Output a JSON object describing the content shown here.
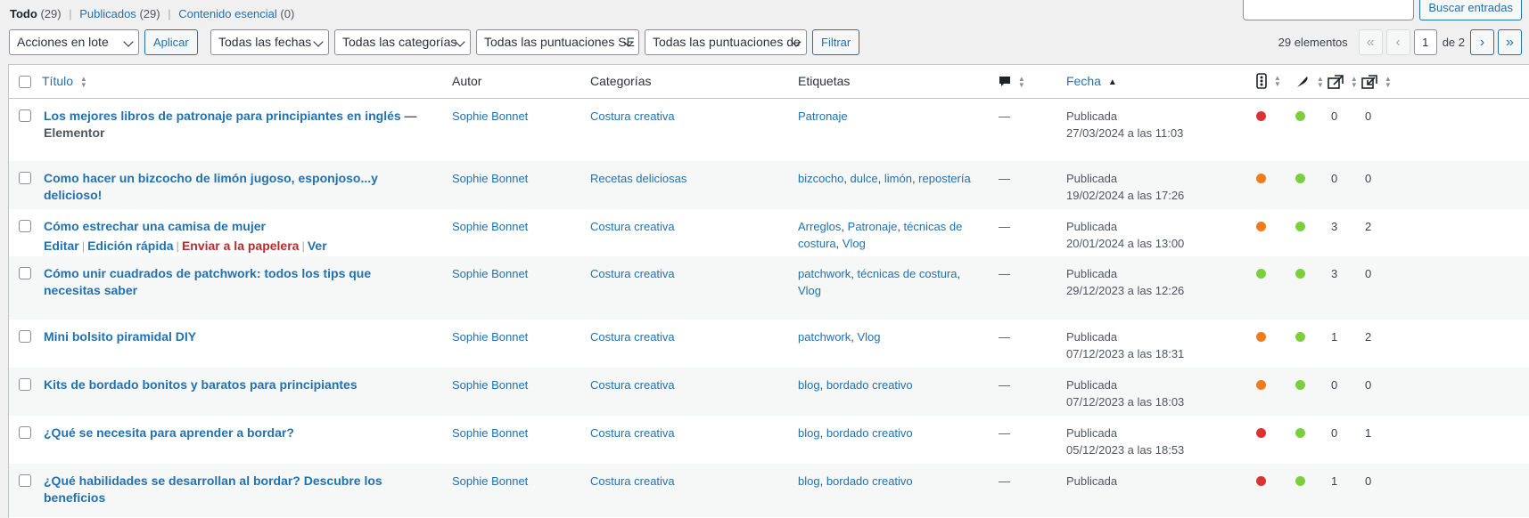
{
  "filters_nav": {
    "all_label": "Todo",
    "all_count": "(29)",
    "published_label": "Publicados",
    "published_count": "(29)",
    "essential_label": "Contenido esencial",
    "essential_count": "(0)"
  },
  "search": {
    "placeholder": "",
    "button_label": "Buscar entradas"
  },
  "toolbar": {
    "bulk_actions": "Acciones en lote",
    "apply_label": "Aplicar",
    "dates_filter": "Todas las fechas",
    "categories_filter": "Todas las categorías",
    "seo_scores_filter": "Todas las puntuaciones SE",
    "readability_filter": "Todas las puntuaciones de",
    "filter_label": "Filtrar"
  },
  "pagination": {
    "items_count": "29 elementos",
    "first": "«",
    "prev": "‹",
    "current_page": "1",
    "of_label": "de 2",
    "next": "›",
    "last": "»"
  },
  "columns": {
    "title": "Título",
    "author": "Autor",
    "categories": "Categorías",
    "tags": "Etiquetas",
    "date": "Fecha"
  },
  "status_colors": {
    "red": "#dc3232",
    "orange": "#ee7c1b",
    "green": "#7ad03a"
  },
  "posts": [
    {
      "title": "Los mejores libros de patronaje para principiantes en inglés",
      "title_suffix": " — Elementor",
      "author": "Sophie Bonnet",
      "category": "Costura creativa",
      "tags": [
        "Patronaje"
      ],
      "comments": "—",
      "status": "Publicada",
      "date": "27/03/2024 a las 11:03",
      "seo": "red",
      "readability": "green",
      "links_in": "0",
      "links_out": "0"
    },
    {
      "title": "Como hacer un bizcocho de limón jugoso, esponjoso...y delicioso!",
      "title_suffix": "",
      "author": "Sophie Bonnet",
      "category": "Recetas deliciosas",
      "tags": [
        "bizcocho",
        "dulce",
        "limón",
        "repostería"
      ],
      "comments": "—",
      "status": "Publicada",
      "date": "19/02/2024 a las 17:26",
      "seo": "orange",
      "readability": "green",
      "links_in": "0",
      "links_out": "0"
    },
    {
      "title": "Cómo estrechar una camisa de mujer",
      "title_suffix": "",
      "author": "Sophie Bonnet",
      "category": "Costura creativa",
      "tags": [
        "Arreglos",
        "Patronaje",
        "técnicas de costura",
        "Vlog"
      ],
      "comments": "—",
      "status": "Publicada",
      "date": "20/01/2024 a las 13:00",
      "seo": "orange",
      "readability": "green",
      "links_in": "3",
      "links_out": "2",
      "row_actions": [
        "Editar",
        "Edición rápida",
        "Enviar a la papelera",
        "Ver"
      ]
    },
    {
      "title": "Cómo unir cuadrados de patchwork: todos los tips que necesitas saber",
      "title_suffix": "",
      "author": "Sophie Bonnet",
      "category": "Costura creativa",
      "tags": [
        "patchwork",
        "técnicas de costura",
        "Vlog"
      ],
      "comments": "—",
      "status": "Publicada",
      "date": "29/12/2023 a las 12:26",
      "seo": "green",
      "readability": "green",
      "links_in": "3",
      "links_out": "0"
    },
    {
      "title": "Mini bolsito piramidal DIY",
      "title_suffix": "",
      "author": "Sophie Bonnet",
      "category": "Costura creativa",
      "tags": [
        "patchwork",
        "Vlog"
      ],
      "comments": "—",
      "status": "Publicada",
      "date": "07/12/2023 a las 18:31",
      "seo": "orange",
      "readability": "green",
      "links_in": "1",
      "links_out": "2"
    },
    {
      "title": "Kits de bordado bonitos y baratos para principiantes",
      "title_suffix": "",
      "author": "Sophie Bonnet",
      "category": "Costura creativa",
      "tags": [
        "blog",
        "bordado creativo"
      ],
      "comments": "—",
      "status": "Publicada",
      "date": "07/12/2023 a las 18:03",
      "seo": "orange",
      "readability": "green",
      "links_in": "0",
      "links_out": "0"
    },
    {
      "title": "¿Qué se necesita para aprender a bordar?",
      "title_suffix": "",
      "author": "Sophie Bonnet",
      "category": "Costura creativa",
      "tags": [
        "blog",
        "bordado creativo"
      ],
      "comments": "—",
      "status": "Publicada",
      "date": "05/12/2023 a las 18:53",
      "seo": "red",
      "readability": "green",
      "links_in": "0",
      "links_out": "1"
    },
    {
      "title": "¿Qué habilidades se desarrollan al bordar? Descubre los beneficios",
      "title_suffix": "",
      "author": "Sophie Bonnet",
      "category": "Costura creativa",
      "tags": [
        "blog",
        "bordado creativo"
      ],
      "comments": "—",
      "status": "Publicada",
      "date": "",
      "seo": "red",
      "readability": "green",
      "links_in": "1",
      "links_out": "0"
    }
  ]
}
